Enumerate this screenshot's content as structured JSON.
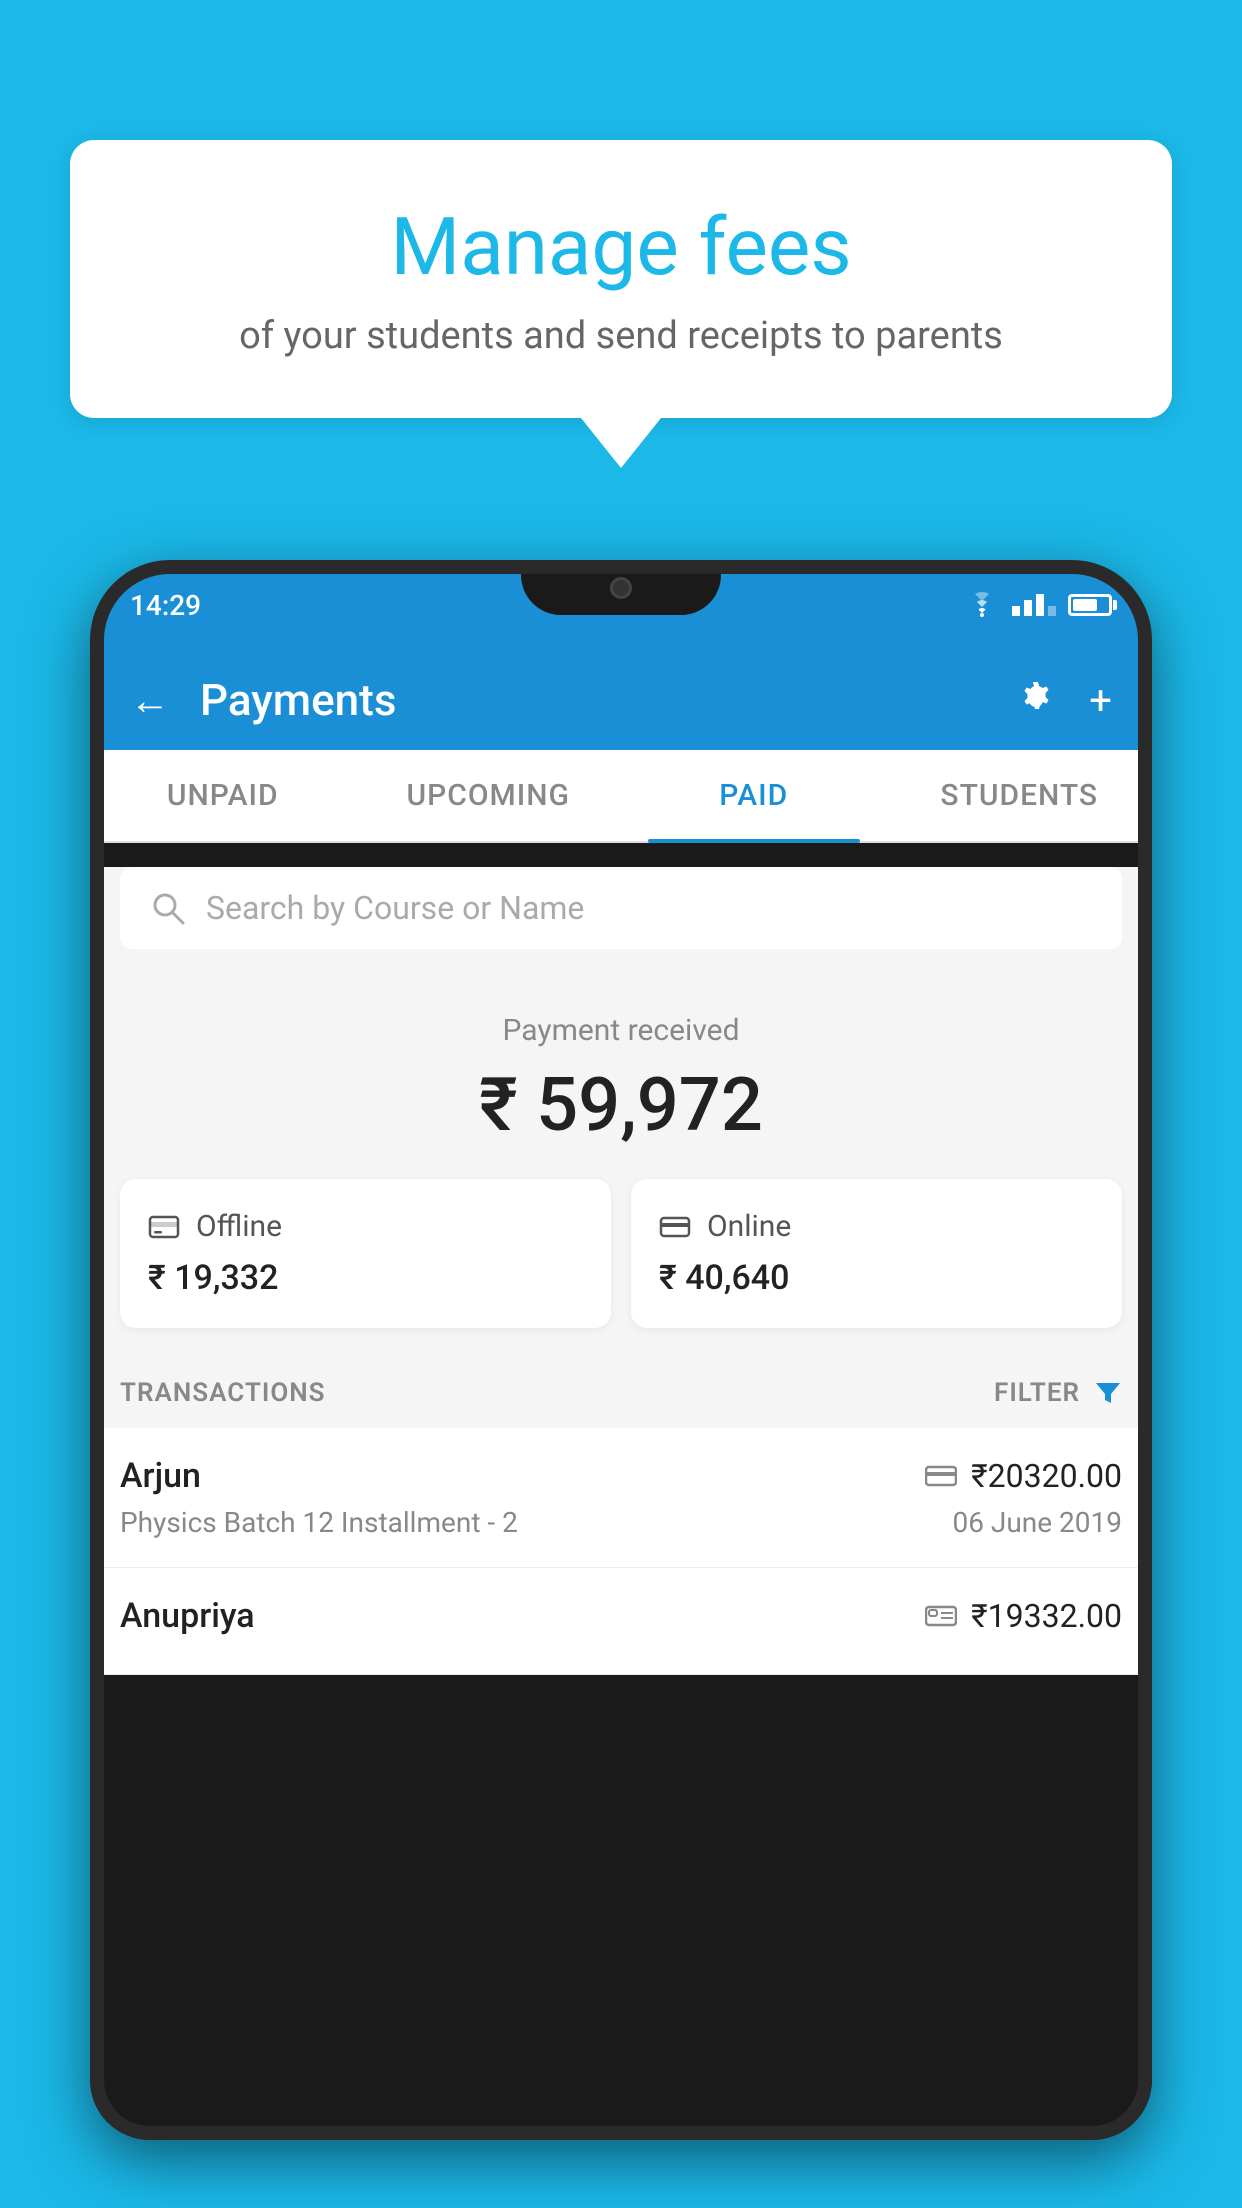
{
  "background_color": "#1BB8E8",
  "speech_bubble": {
    "title": "Manage fees",
    "subtitle": "of your students and send receipts to parents"
  },
  "phone": {
    "status_bar": {
      "time": "14:29"
    },
    "header": {
      "title": "Payments",
      "back_label": "←",
      "gear_label": "⚙",
      "plus_label": "+"
    },
    "tabs": [
      {
        "label": "UNPAID",
        "active": false
      },
      {
        "label": "UPCOMING",
        "active": false
      },
      {
        "label": "PAID",
        "active": true
      },
      {
        "label": "STUDENTS",
        "active": false
      }
    ],
    "search": {
      "placeholder": "Search by Course or Name"
    },
    "payment_received": {
      "label": "Payment received",
      "amount": "₹ 59,972"
    },
    "payment_cards": [
      {
        "icon": "offline",
        "label": "Offline",
        "amount": "₹ 19,332"
      },
      {
        "icon": "online",
        "label": "Online",
        "amount": "₹ 40,640"
      }
    ],
    "transactions_label": "TRANSACTIONS",
    "filter_label": "FILTER",
    "transactions": [
      {
        "name": "Arjun",
        "course": "Physics Batch 12 Installment - 2",
        "amount": "₹20320.00",
        "date": "06 June 2019",
        "icon": "card"
      },
      {
        "name": "Anupriya",
        "course": "",
        "amount": "₹19332.00",
        "date": "",
        "icon": "cash"
      }
    ]
  }
}
